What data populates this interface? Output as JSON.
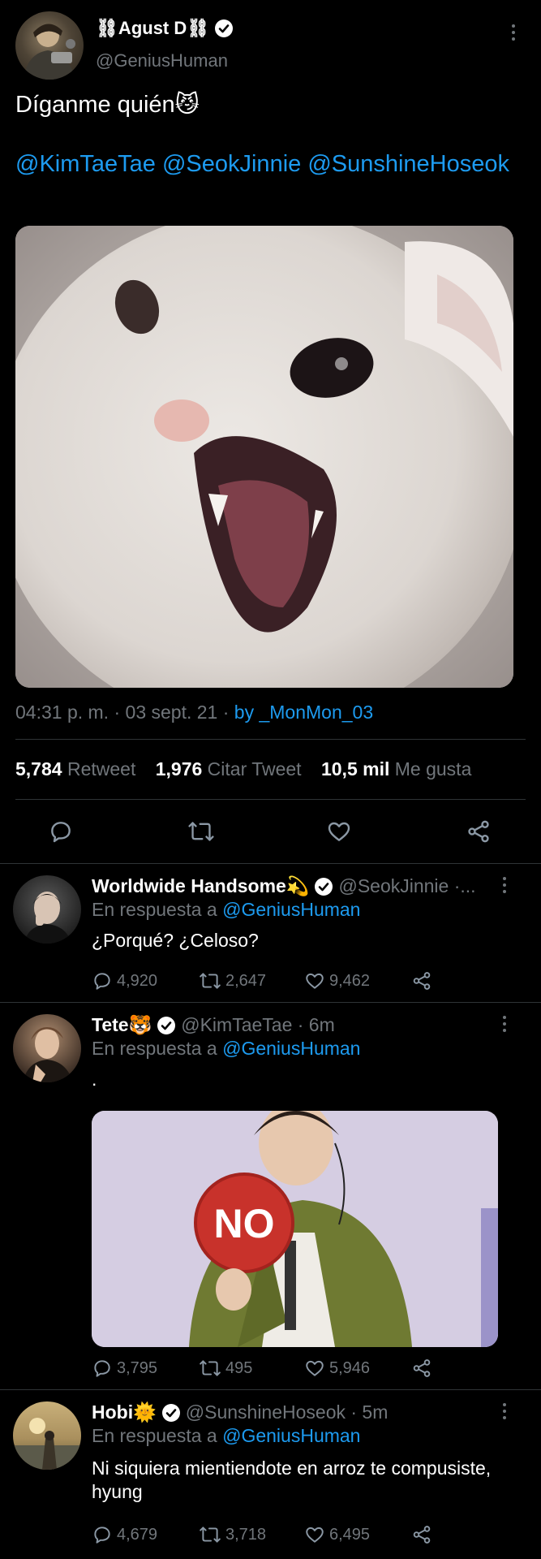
{
  "main_tweet": {
    "author_name": "⛓Agust D⛓",
    "author_handle": "@GeniusHuman",
    "text": "Díganme quién😼",
    "mentions": "@KimTaeTae @SeokJinnie @SunshineHoseok",
    "time": "04:31 p. m.",
    "date": "03 sept. 21",
    "source": "by _MonMon_03",
    "retweets": "5,784",
    "retweets_label": "Retweet",
    "quotes": "1,976",
    "quotes_label": "Citar Tweet",
    "likes": "10,5 mil",
    "likes_label": "Me gusta"
  },
  "replies": [
    {
      "name": "Worldwide Handsome💫",
      "handle": "@SeokJinnie ·...",
      "in_reply_label": "En respuesta a",
      "in_reply_to": "@GeniusHuman",
      "text": "¿Porqué? ¿Celoso?",
      "comments": "4,920",
      "retweets": "2,647",
      "likes": "9,462"
    },
    {
      "name": "Tete🐯",
      "handle": "@KimTaeTae · 6m",
      "in_reply_label": "En respuesta a",
      "in_reply_to": "@GeniusHuman",
      "text": ".",
      "media_sign_text": "NO",
      "comments": "3,795",
      "retweets": "495",
      "likes": "5,946"
    },
    {
      "name": "Hobi🌞",
      "handle": "@SunshineHoseok · 5m",
      "in_reply_label": "En respuesta a",
      "in_reply_to": "@GeniusHuman",
      "text": "Ni siquiera mientiendote en arroz te compusiste, hyung",
      "comments": "4,679",
      "retweets": "3,718",
      "likes": "6,495"
    }
  ],
  "colors": {
    "background": "#000000",
    "accent": "#1d9bf0",
    "muted": "#71767b",
    "divider": "#2f3336"
  }
}
